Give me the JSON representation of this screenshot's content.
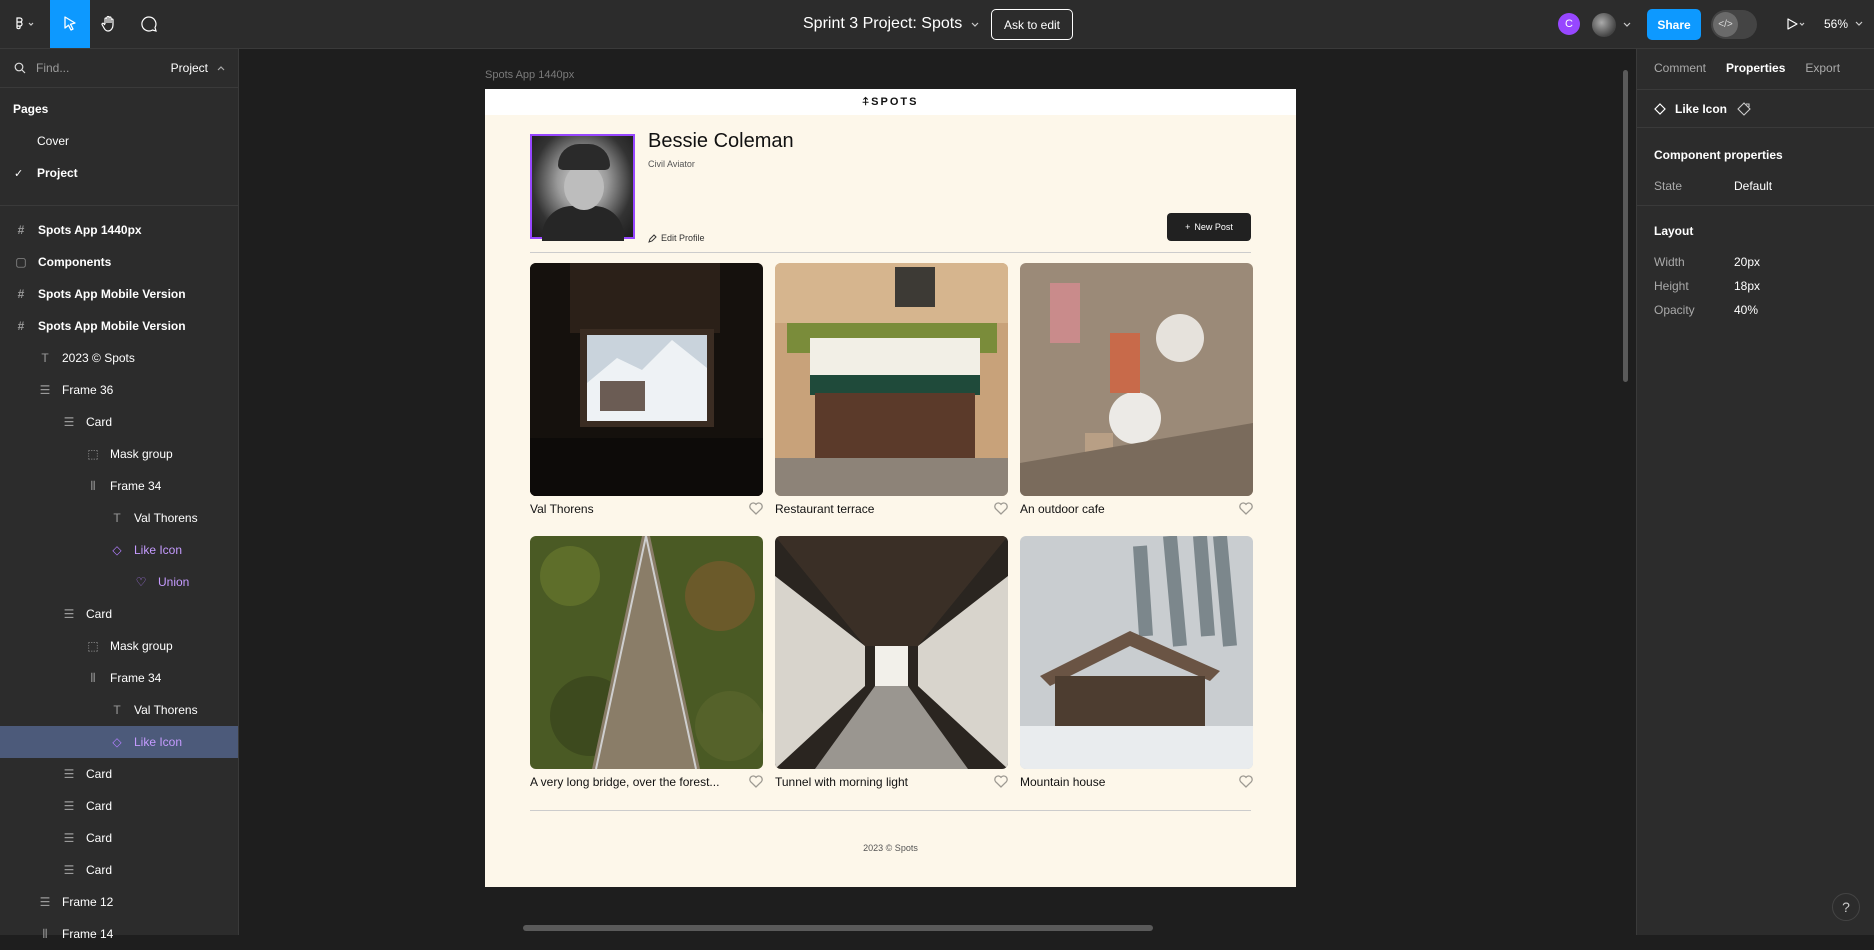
{
  "toolbar": {
    "file_title": "Sprint 3 Project: Spots",
    "ask_to_edit": "Ask to edit",
    "avatar_initial": "C",
    "share": "Share",
    "zoom": "56%"
  },
  "left_panel": {
    "find_placeholder": "Find...",
    "scope": "Project",
    "pages_title": "Pages",
    "pages": [
      {
        "label": "Cover",
        "selected": false
      },
      {
        "label": "Project",
        "selected": true
      }
    ],
    "layers": [
      {
        "label": "Spots App 1440px",
        "icon": "frame-icon",
        "bold": true
      },
      {
        "label": "Components",
        "icon": "section-icon",
        "bold": true
      },
      {
        "label": "Spots App Mobile Version",
        "icon": "frame-icon",
        "bold": true
      },
      {
        "label": "Spots App Mobile Version",
        "icon": "frame-icon",
        "bold": true
      },
      {
        "label": "2023 © Spots",
        "icon": "text-icon"
      },
      {
        "label": "Frame 36",
        "icon": "auto-layout-vertical-icon"
      },
      {
        "label": "Card",
        "icon": "auto-layout-vertical-icon"
      },
      {
        "label": "Mask group",
        "icon": "mask-group-icon"
      },
      {
        "label": "Frame 34",
        "icon": "auto-layout-horizontal-icon"
      },
      {
        "label": "Val Thorens",
        "icon": "text-icon"
      },
      {
        "label": "Like Icon",
        "icon": "component-instance-icon"
      },
      {
        "label": "Union",
        "icon": "heart-icon"
      },
      {
        "label": "Card",
        "icon": "auto-layout-vertical-icon"
      },
      {
        "label": "Mask group",
        "icon": "mask-group-icon"
      },
      {
        "label": "Frame 34",
        "icon": "auto-layout-horizontal-icon"
      },
      {
        "label": "Val Thorens",
        "icon": "text-icon"
      },
      {
        "label": "Like Icon",
        "icon": "component-instance-icon"
      },
      {
        "label": "Card",
        "icon": "auto-layout-vertical-icon"
      },
      {
        "label": "Card",
        "icon": "auto-layout-vertical-icon"
      },
      {
        "label": "Card",
        "icon": "auto-layout-vertical-icon"
      },
      {
        "label": "Card",
        "icon": "auto-layout-vertical-icon"
      },
      {
        "label": "Frame 12",
        "icon": "auto-layout-vertical-icon"
      },
      {
        "label": "Frame 14",
        "icon": "auto-layout-horizontal-icon"
      }
    ]
  },
  "right_panel": {
    "tabs": [
      "Comment",
      "Properties",
      "Export"
    ],
    "active_tab": "Properties",
    "selection_name": "Like Icon",
    "component_properties_title": "Component properties",
    "state_label": "State",
    "state_value": "Default",
    "layout_title": "Layout",
    "width_label": "Width",
    "width_value": "20px",
    "height_label": "Height",
    "height_value": "18px",
    "opacity_label": "Opacity",
    "opacity_value": "40%"
  },
  "canvas": {
    "frame_label": "Spots App 1440px",
    "logo": "⍏SPOTS",
    "profile_name": "Bessie Coleman",
    "profile_role": "Civil Aviator",
    "edit_profile": "Edit Profile",
    "new_post": "New Post",
    "cards": [
      {
        "title": "Val Thorens"
      },
      {
        "title": "Restaurant terrace"
      },
      {
        "title": "An outdoor cafe"
      },
      {
        "title": "A very long bridge, over the forest..."
      },
      {
        "title": "Tunnel with morning light"
      },
      {
        "title": "Mountain house"
      }
    ],
    "footer": "2023 © Spots"
  },
  "colors": {
    "accent_purple": "#9747ff",
    "share_blue": "#0d99ff",
    "selected_layer": "#4c5a7a",
    "frame_bg": "#fdf7ea"
  }
}
